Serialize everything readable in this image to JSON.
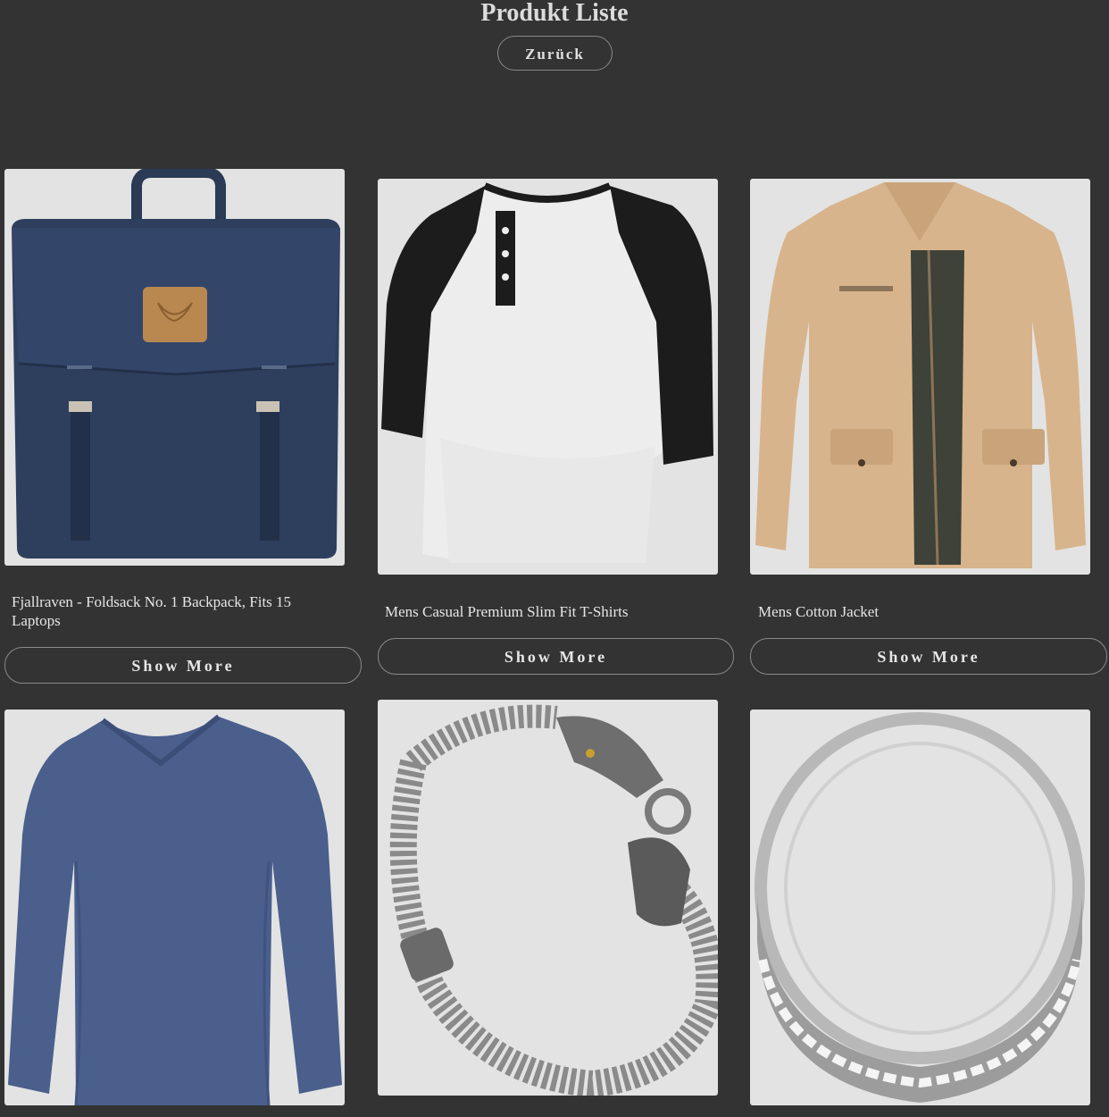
{
  "header": {
    "title": "Produkt Liste",
    "back_label": "Zurück"
  },
  "products": [
    {
      "title": "Fjallraven - Foldsack No. 1 Backpack, Fits 15 Laptops",
      "button_label": "Show More",
      "image": "backpack-image"
    },
    {
      "title": "Mens Casual Premium Slim Fit T-Shirts",
      "button_label": "Show More",
      "image": "raglan-shirt-image"
    },
    {
      "title": "Mens Cotton Jacket",
      "button_label": "Show More",
      "image": "jacket-image"
    },
    {
      "image": "longsleeve-shirt-image"
    },
    {
      "image": "bracelet-image"
    },
    {
      "image": "ring-image"
    }
  ],
  "colors": {
    "background": "#333333",
    "card_background": "#e3e3e3",
    "text": "#e6e6e6",
    "button_border": "#8a8a8a"
  }
}
